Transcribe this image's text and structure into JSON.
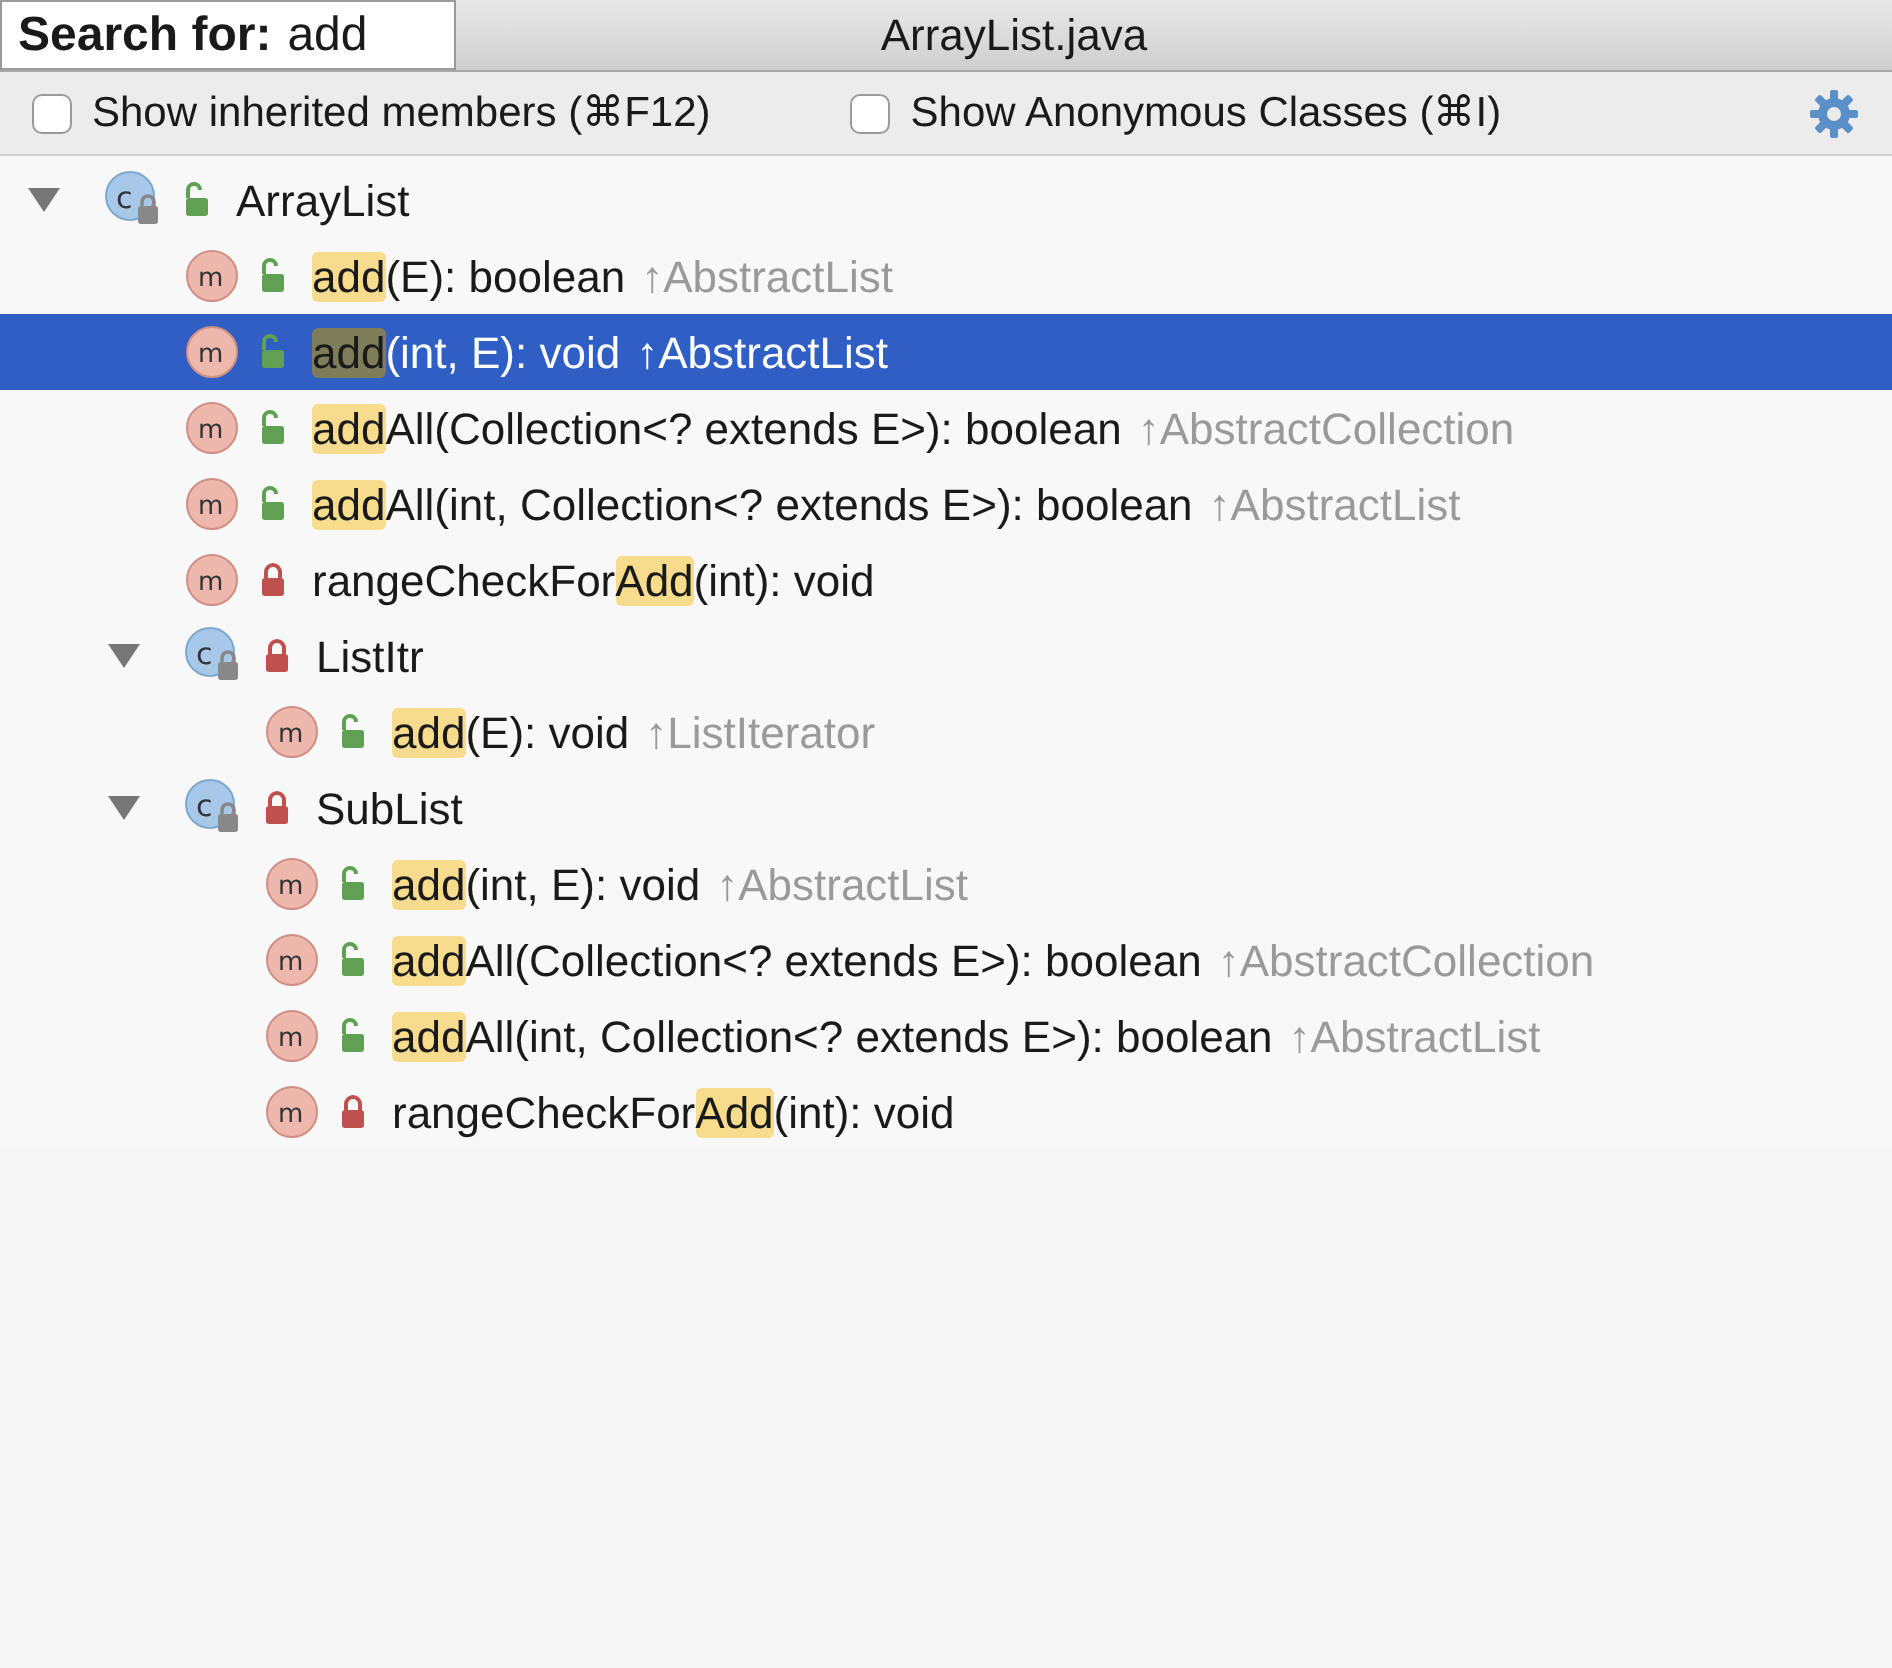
{
  "search": {
    "label": "Search for:",
    "value": "add"
  },
  "window": {
    "title": "ArrayList.java"
  },
  "options": [
    {
      "label": "Show inherited members (⌘F12)",
      "checked": false
    },
    {
      "label": "Show Anonymous Classes (⌘I)",
      "checked": false
    }
  ],
  "tree": [
    {
      "kind": "class",
      "icon_letter": "c",
      "private": false,
      "expanded": true,
      "selected": false,
      "parts": [
        {
          "text": "ArrayList",
          "match": false
        }
      ],
      "children": [
        {
          "kind": "method",
          "icon_letter": "m",
          "private": false,
          "selected": false,
          "parts": [
            {
              "text": "add",
              "match": true
            },
            {
              "text": "(E): boolean",
              "match": false
            }
          ],
          "origin": "↑AbstractList"
        },
        {
          "kind": "method",
          "icon_letter": "m",
          "private": false,
          "selected": true,
          "parts": [
            {
              "text": "add",
              "match": true
            },
            {
              "text": "(int, E): void",
              "match": false
            }
          ],
          "origin": "↑AbstractList"
        },
        {
          "kind": "method",
          "icon_letter": "m",
          "private": false,
          "selected": false,
          "parts": [
            {
              "text": "add",
              "match": true
            },
            {
              "text": "All(Collection<? extends E>): boolean",
              "match": false
            }
          ],
          "origin": "↑AbstractCollection"
        },
        {
          "kind": "method",
          "icon_letter": "m",
          "private": false,
          "selected": false,
          "parts": [
            {
              "text": "add",
              "match": true
            },
            {
              "text": "All(int, Collection<? extends E>): boolean",
              "match": false
            }
          ],
          "origin": "↑AbstractList"
        },
        {
          "kind": "method",
          "icon_letter": "m",
          "private": true,
          "selected": false,
          "parts": [
            {
              "text": "rangeCheckFor",
              "match": false
            },
            {
              "text": "Add",
              "match": true
            },
            {
              "text": "(int): void",
              "match": false
            }
          ]
        },
        {
          "kind": "class",
          "icon_letter": "c",
          "private": true,
          "expanded": true,
          "selected": false,
          "parts": [
            {
              "text": "ListItr",
              "match": false
            }
          ],
          "children": [
            {
              "kind": "method",
              "icon_letter": "m",
              "private": false,
              "selected": false,
              "parts": [
                {
                  "text": "add",
                  "match": true
                },
                {
                  "text": "(E): void",
                  "match": false
                }
              ],
              "origin": "↑ListIterator"
            }
          ]
        },
        {
          "kind": "class",
          "icon_letter": "c",
          "private": true,
          "expanded": true,
          "selected": false,
          "parts": [
            {
              "text": "SubList",
              "match": false
            }
          ],
          "children": [
            {
              "kind": "method",
              "icon_letter": "m",
              "private": false,
              "selected": false,
              "parts": [
                {
                  "text": "add",
                  "match": true
                },
                {
                  "text": "(int, E): void",
                  "match": false
                }
              ],
              "origin": "↑AbstractList"
            },
            {
              "kind": "method",
              "icon_letter": "m",
              "private": false,
              "selected": false,
              "parts": [
                {
                  "text": "add",
                  "match": true
                },
                {
                  "text": "All(Collection<? extends E>): boolean",
                  "match": false
                }
              ],
              "origin": "↑AbstractCollection"
            },
            {
              "kind": "method",
              "icon_letter": "m",
              "private": false,
              "selected": false,
              "parts": [
                {
                  "text": "add",
                  "match": true
                },
                {
                  "text": "All(int, Collection<? extends E>): boolean",
                  "match": false
                }
              ],
              "origin": "↑AbstractList"
            },
            {
              "kind": "method",
              "icon_letter": "m",
              "private": true,
              "selected": false,
              "parts": [
                {
                  "text": "rangeCheckFor",
                  "match": false
                },
                {
                  "text": "Add",
                  "match": true
                },
                {
                  "text": "(int): void",
                  "match": false
                }
              ]
            }
          ]
        }
      ]
    }
  ]
}
